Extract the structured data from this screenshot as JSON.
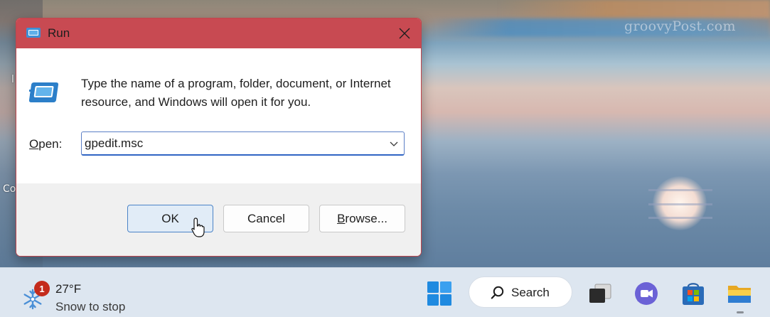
{
  "desktop": {
    "watermark": "groovyPost.com",
    "left_fragments": [
      "l",
      "Co"
    ]
  },
  "dialog": {
    "title": "Run",
    "description": "Type the name of a program, folder, document, or Internet resource, and Windows will open it for you.",
    "open_label_prefix": "O",
    "open_label_rest": "pen:",
    "open_value": "gpedit.msc",
    "buttons": {
      "ok": "OK",
      "cancel": "Cancel",
      "browse_prefix": "B",
      "browse_rest": "rowse..."
    },
    "colors": {
      "titlebar": "#c84a52",
      "ok_border": "#4b83c7",
      "ok_fill": "#e1ecf7"
    }
  },
  "taskbar": {
    "weather": {
      "badge_count": "1",
      "temperature": "27°F",
      "condition": "Snow to stop"
    },
    "search_label": "Search",
    "icons": [
      "start-icon",
      "search-icon",
      "task-view-icon",
      "teams-chat-icon",
      "microsoft-store-icon",
      "file-explorer-icon"
    ]
  }
}
